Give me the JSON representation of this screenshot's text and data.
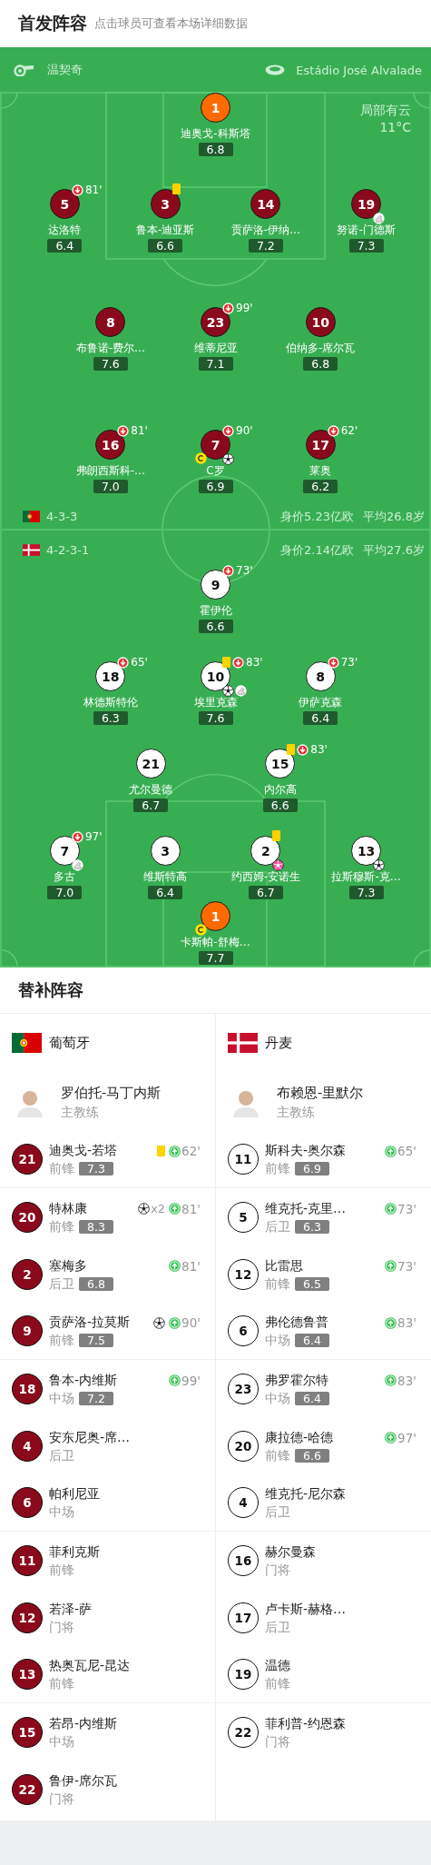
{
  "header": {
    "title": "首发阵容",
    "subtitle": "点击球员可查看本场详细数据"
  },
  "pitch": {
    "referee": "温契奇",
    "venue": "Estádio José Alvalade",
    "weather": "局部有云",
    "temperature": "11°C",
    "teams": [
      {
        "formation": "4-3-3",
        "value": "身价5.23亿欧",
        "age": "平均26.8岁",
        "lines": [
          [
            {
              "number": "1",
              "name": "迪奥戈-科斯塔",
              "rating": "6.8",
              "kind": "goalkeeper"
            }
          ],
          [
            {
              "number": "5",
              "name": "达洛特",
              "rating": "6.4",
              "kind": "outfield",
              "events": [
                {
                  "kind": "sub_off",
                  "minute": "81'"
                }
              ]
            },
            {
              "number": "3",
              "name": "鲁本-迪亚斯",
              "rating": "6.6",
              "kind": "outfield",
              "events": [
                {
                  "kind": "yellow_card"
                }
              ]
            },
            {
              "number": "14",
              "name": "贡萨洛-伊纳…",
              "rating": "7.2",
              "kind": "outfield"
            },
            {
              "number": "19",
              "name": "努诺-门德斯",
              "rating": "7.3",
              "kind": "outfield",
              "events": [
                {
                  "kind": "assist"
                }
              ]
            }
          ],
          [
            {
              "number": "8",
              "name": "布鲁诺-费尔…",
              "rating": "7.6",
              "kind": "outfield"
            },
            {
              "number": "23",
              "name": "维蒂尼亚",
              "rating": "7.1",
              "kind": "outfield",
              "events": [
                {
                  "kind": "sub_off",
                  "minute": "99'"
                }
              ]
            },
            {
              "number": "10",
              "name": "伯纳多-席尔瓦",
              "rating": "6.8",
              "kind": "outfield"
            }
          ],
          [
            {
              "number": "16",
              "name": "弗朗西斯科-…",
              "rating": "7.0",
              "kind": "outfield",
              "events": [
                {
                  "kind": "sub_off",
                  "minute": "81'"
                }
              ]
            },
            {
              "number": "7",
              "name": "C罗",
              "rating": "6.9",
              "kind": "outfield",
              "captain": true,
              "events": [
                {
                  "kind": "sub_off",
                  "minute": "90'"
                },
                {
                  "kind": "goal"
                }
              ]
            },
            {
              "number": "17",
              "name": "莱奥",
              "rating": "6.2",
              "kind": "outfield",
              "events": [
                {
                  "kind": "sub_off",
                  "minute": "62'"
                }
              ]
            }
          ]
        ]
      },
      {
        "formation": "4-2-3-1",
        "value": "身价2.14亿欧",
        "age": "平均27.6岁",
        "lines": [
          [
            {
              "number": "9",
              "name": "霍伊伦",
              "rating": "6.6",
              "kind": "outfield",
              "events": [
                {
                  "kind": "sub_off",
                  "minute": "73'"
                }
              ]
            }
          ],
          [
            {
              "number": "18",
              "name": "林德斯特伦",
              "rating": "6.3",
              "kind": "outfield",
              "events": [
                {
                  "kind": "sub_off",
                  "minute": "65'"
                }
              ]
            },
            {
              "number": "10",
              "name": "埃里克森",
              "rating": "7.6",
              "kind": "outfield",
              "events": [
                {
                  "kind": "yellow_card"
                },
                {
                  "kind": "sub_off",
                  "minute": "83'"
                },
                {
                  "kind": "goal"
                },
                {
                  "kind": "assist"
                }
              ]
            },
            {
              "number": "8",
              "name": "伊萨克森",
              "rating": "6.4",
              "kind": "outfield",
              "events": [
                {
                  "kind": "sub_off",
                  "minute": "73'"
                }
              ]
            }
          ],
          [
            {
              "number": "21",
              "name": "尤尔曼德",
              "rating": "6.7",
              "kind": "outfield"
            },
            {
              "number": "15",
              "name": "内尔高",
              "rating": "6.6",
              "kind": "outfield",
              "events": [
                {
                  "kind": "yellow_card"
                },
                {
                  "kind": "sub_off",
                  "minute": "83'"
                }
              ]
            }
          ],
          [
            {
              "number": "7",
              "name": "多古",
              "rating": "7.0",
              "kind": "outfield",
              "events": [
                {
                  "kind": "sub_off",
                  "minute": "97'"
                },
                {
                  "kind": "assist"
                }
              ]
            },
            {
              "number": "3",
              "name": "维斯特高",
              "rating": "6.4",
              "kind": "outfield"
            },
            {
              "number": "2",
              "name": "约西姆-安诺生",
              "rating": "6.7",
              "kind": "outfield",
              "events": [
                {
                  "kind": "yellow_card"
                },
                {
                  "kind": "own_goal"
                }
              ]
            },
            {
              "number": "13",
              "name": "拉斯穆斯-克…",
              "rating": "7.3",
              "kind": "outfield",
              "events": [
                {
                  "kind": "goal"
                }
              ]
            }
          ],
          [
            {
              "number": "1",
              "name": "卡斯帕-舒梅…",
              "rating": "7.7",
              "kind": "goalkeeper",
              "captain": true
            }
          ]
        ]
      }
    ]
  },
  "subs": {
    "title": "替补阵容",
    "teams": [
      {
        "name": "葡萄牙",
        "coach": {
          "name": "罗伯托-马丁内斯",
          "role": "主教练"
        },
        "players": [
          {
            "number": "21",
            "name": "迪奥戈-若塔",
            "position": "前锋",
            "rating": "7.3",
            "events": [
              {
                "kind": "yellow_card"
              },
              {
                "kind": "sub_on",
                "minute": "62'"
              }
            ]
          },
          {
            "number": "20",
            "name": "特林康",
            "position": "前锋",
            "rating": "8.3",
            "events": [
              {
                "kind": "goal",
                "count": "x2"
              },
              {
                "kind": "sub_on",
                "minute": "81'"
              }
            ]
          },
          {
            "number": "2",
            "name": "塞梅多",
            "position": "后卫",
            "rating": "6.8",
            "events": [
              {
                "kind": "sub_on",
                "minute": "81'"
              }
            ]
          },
          {
            "number": "9",
            "name": "贡萨洛-拉莫斯",
            "position": "前锋",
            "rating": "7.5",
            "events": [
              {
                "kind": "goal"
              },
              {
                "kind": "sub_on",
                "minute": "90'"
              }
            ]
          },
          {
            "number": "18",
            "name": "鲁本-内维斯",
            "position": "中场",
            "rating": "7.2",
            "events": [
              {
                "kind": "sub_on",
                "minute": "99'"
              }
            ]
          },
          {
            "number": "4",
            "name": "安东尼奥-席…",
            "position": "后卫"
          },
          {
            "number": "6",
            "name": "帕利尼亚",
            "position": "中场"
          },
          {
            "number": "11",
            "name": "菲利克斯",
            "position": "前锋"
          },
          {
            "number": "12",
            "name": "若泽-萨",
            "position": "门将"
          },
          {
            "number": "13",
            "name": "热奥瓦尼-昆达",
            "position": "前锋"
          },
          {
            "number": "15",
            "name": "若昂-内维斯",
            "position": "中场"
          },
          {
            "number": "22",
            "name": "鲁伊-席尔瓦",
            "position": "门将"
          }
        ]
      },
      {
        "name": "丹麦",
        "coach": {
          "name": "布赖恩-里默尔",
          "role": "主教练"
        },
        "players": [
          {
            "number": "11",
            "name": "斯科夫-奥尔森",
            "position": "前锋",
            "rating": "6.9",
            "events": [
              {
                "kind": "sub_on",
                "minute": "65'"
              }
            ]
          },
          {
            "number": "5",
            "name": "维克托-克里…",
            "position": "后卫",
            "rating": "6.3",
            "events": [
              {
                "kind": "sub_on",
                "minute": "73'"
              }
            ]
          },
          {
            "number": "12",
            "name": "比雷思",
            "position": "前锋",
            "rating": "6.5",
            "events": [
              {
                "kind": "sub_on",
                "minute": "73'"
              }
            ]
          },
          {
            "number": "6",
            "name": "弗伦德鲁普",
            "position": "中场",
            "rating": "6.4",
            "events": [
              {
                "kind": "sub_on",
                "minute": "83'"
              }
            ]
          },
          {
            "number": "23",
            "name": "弗罗霍尔特",
            "position": "中场",
            "rating": "6.4",
            "events": [
              {
                "kind": "sub_on",
                "minute": "83'"
              }
            ]
          },
          {
            "number": "20",
            "name": "康拉德-哈德",
            "position": "前锋",
            "rating": "6.6",
            "events": [
              {
                "kind": "sub_on",
                "minute": "97'"
              }
            ]
          },
          {
            "number": "4",
            "name": "维克托-尼尔森",
            "position": "后卫"
          },
          {
            "number": "16",
            "name": "赫尔曼森",
            "position": "门将"
          },
          {
            "number": "17",
            "name": "卢卡斯-赫格…",
            "position": "后卫"
          },
          {
            "number": "19",
            "name": "温德",
            "position": "前锋"
          },
          {
            "number": "22",
            "name": "菲利普-约恩森",
            "position": "门将"
          }
        ]
      }
    ]
  }
}
